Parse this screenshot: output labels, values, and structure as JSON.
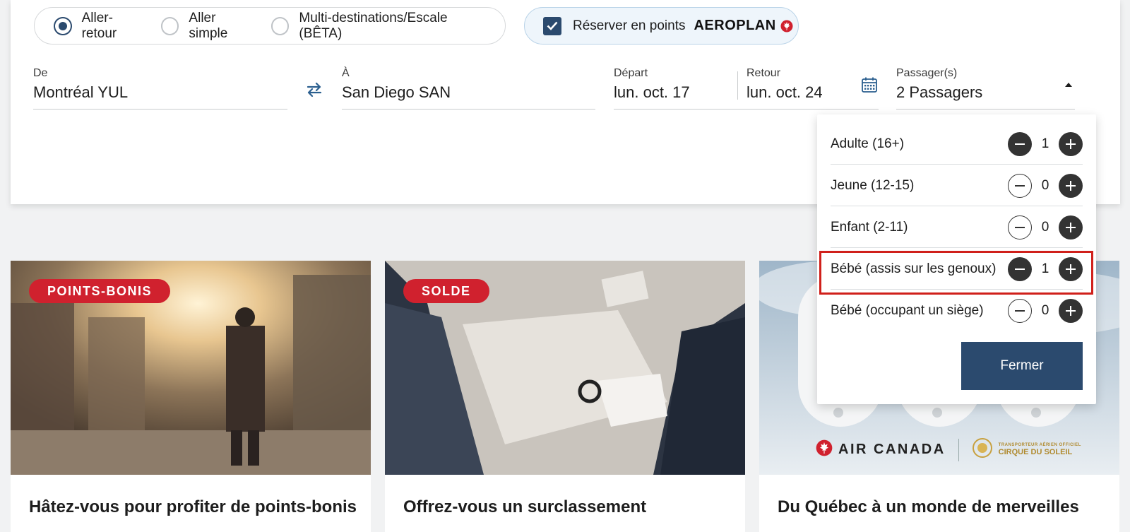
{
  "trip_type": {
    "options": [
      {
        "label": "Aller-retour",
        "selected": true
      },
      {
        "label": "Aller simple",
        "selected": false
      },
      {
        "label": "Multi-destinations/Escale (BÊTA)",
        "selected": false
      }
    ]
  },
  "points": {
    "label": "Réserver en points",
    "checked": true,
    "brand": "AEROPLAN"
  },
  "search": {
    "from": {
      "label": "De",
      "value": "Montréal YUL"
    },
    "to": {
      "label": "À",
      "value": "San Diego SAN"
    },
    "depart": {
      "label": "Départ",
      "value": "lun. oct. 17"
    },
    "return": {
      "label": "Retour",
      "value": "lun. oct. 24"
    },
    "passengers": {
      "label": "Passager(s)",
      "value": "2 Passagers"
    }
  },
  "passenger_dropdown": {
    "rows": [
      {
        "label": "Adulte (16+)",
        "count": "1"
      },
      {
        "label": "Jeune (12-15)",
        "count": "0"
      },
      {
        "label": "Enfant (2-11)",
        "count": "0"
      },
      {
        "label": "Bébé (assis sur les genoux)",
        "count": "1"
      },
      {
        "label": "Bébé (occupant un siège)",
        "count": "0"
      }
    ],
    "close_label": "Fermer"
  },
  "cards": [
    {
      "badge": "POINTS-BONIS",
      "title": "Hâtez-vous pour profiter de points-bonis"
    },
    {
      "badge": "SOLDE",
      "title": "Offrez-vous un surclassement"
    },
    {
      "badge": "",
      "title": "Du Québec à un monde de merveilles",
      "brand": "AIR CANADA",
      "partner": "CIRQUE DU SOLEIL",
      "partner_tagline": "TRANSPORTEUR AÉRIEN OFFICIEL"
    }
  ],
  "colors": {
    "primary_navy": "#2b4a6e",
    "badge_red": "#d0212e",
    "highlight_red": "#d0201b"
  }
}
